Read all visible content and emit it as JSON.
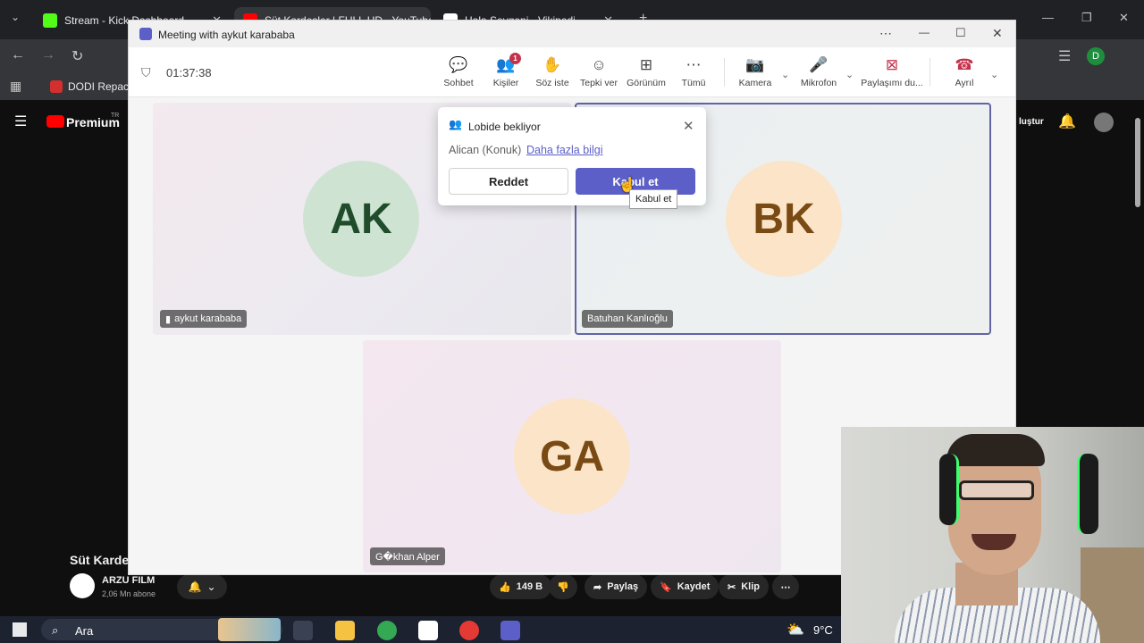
{
  "browser": {
    "tabs": [
      {
        "label": "Stream - Kick Dashboard",
        "color": "#53fc18"
      },
      {
        "label": "Süt Kardeşler | FULL HD - YouTube",
        "color": "#ff0000"
      },
      {
        "label": "Hala Sevgeni - Vikipedi",
        "color": "#ffffff"
      }
    ],
    "bookmark": "DODI Repack",
    "profile_initial": "D"
  },
  "youtube": {
    "brand": "Premium",
    "region": "TR",
    "right_text": "luştur",
    "video_title": "Süt Kardeş",
    "channel_name": "ARZU FILM",
    "subscribers": "2,06 Mn abone",
    "likes": "149 B",
    "share": "Paylaş",
    "save": "Kaydet",
    "clip": "Klip"
  },
  "taskbar": {
    "search": "Ara",
    "temperature": "9°C"
  },
  "teams": {
    "window_title": "Meeting with aykut karababa",
    "timer": "01:37:38",
    "toolbar": {
      "chat": "Sohbet",
      "people": "Kişiler",
      "people_badge": "1",
      "raise_hand": "Söz iste",
      "react": "Tepki ver",
      "view": "Görünüm",
      "more": "Tümü",
      "camera": "Kamera",
      "mic": "Mikrofon",
      "share": "Paylaşımı du...",
      "leave": "Ayrıl"
    },
    "participants": [
      {
        "initials": "AK",
        "name": "aykut karababa",
        "avatar_bg": "#cfe3d3",
        "avatar_fg": "#1f4d2b"
      },
      {
        "initials": "BK",
        "name": "Batuhan Kanlıoğlu",
        "avatar_bg": "#fbe4c8",
        "avatar_fg": "#7a4a14"
      },
      {
        "initials": "GA",
        "name": "G�khan Alper",
        "avatar_bg": "#fbe4c8",
        "avatar_fg": "#7a4a14"
      }
    ],
    "lobby": {
      "title": "Lobide bekliyor",
      "guest": "Alican (Konuk)",
      "more_info": "Daha fazla bilgi",
      "reject": "Reddet",
      "accept": "Kabul et",
      "tooltip": "Kabul et"
    },
    "accent": "#5b5fc7"
  }
}
